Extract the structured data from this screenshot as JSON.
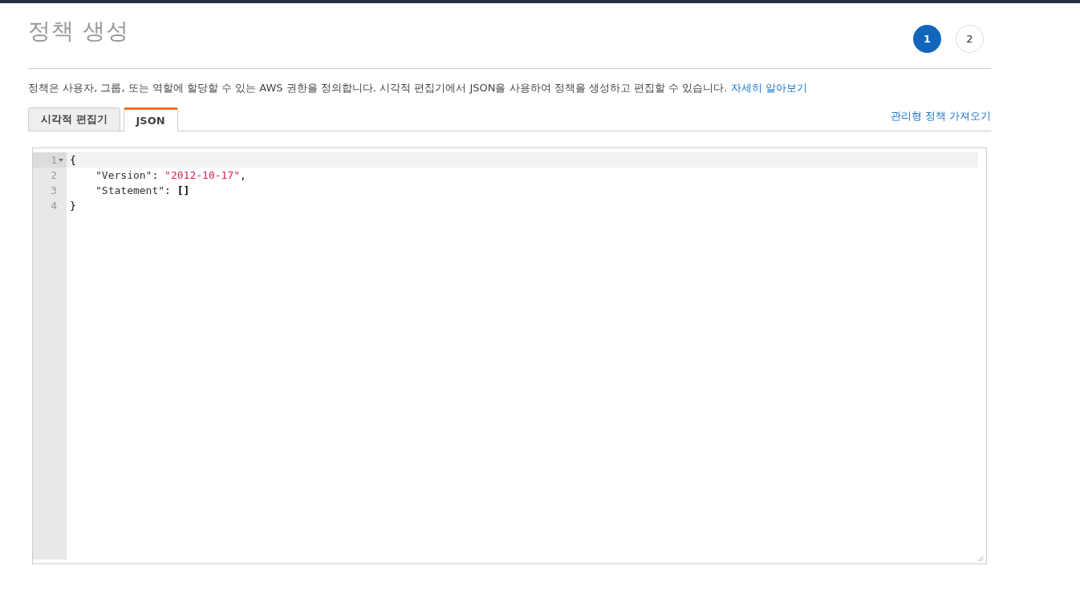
{
  "title": "정책 생성",
  "steps": [
    {
      "label": "1",
      "selected": true
    },
    {
      "label": "2",
      "selected": false
    }
  ],
  "description": {
    "text": "정책은 사용자, 그룹, 또는 역할에 할당할 수 있는 AWS 권한을 정의합니다. 시각적 편집기에서 JSON을 사용하여 정책을 생성하고 편집할 수 있습니다.",
    "link": "자세히 알아보기"
  },
  "tabs": [
    {
      "label": "시각적 편집기",
      "selected": false
    },
    {
      "label": "JSON",
      "selected": true
    }
  ],
  "import_link": "관리형 정책 가져오기",
  "editor": {
    "lines": [
      {
        "number": "1",
        "active": true,
        "foldable": true,
        "indented": false,
        "tokens": [
          {
            "kind": "punct",
            "text": "{"
          }
        ]
      },
      {
        "number": "2",
        "active": false,
        "foldable": false,
        "indented": true,
        "tokens": [
          {
            "kind": "key",
            "text": "\"Version\""
          },
          {
            "kind": "punct",
            "text": ": "
          },
          {
            "kind": "string",
            "text": "\"2012-10-17\""
          },
          {
            "kind": "punct",
            "text": ","
          }
        ]
      },
      {
        "number": "3",
        "active": false,
        "foldable": false,
        "indented": true,
        "tokens": [
          {
            "kind": "key",
            "text": "\"Statement\""
          },
          {
            "kind": "punct",
            "text": ": "
          },
          {
            "kind": "bracket",
            "text": "[]"
          }
        ]
      },
      {
        "number": "4",
        "active": false,
        "foldable": false,
        "indented": false,
        "tokens": [
          {
            "kind": "punct",
            "text": "}"
          }
        ]
      }
    ]
  }
}
